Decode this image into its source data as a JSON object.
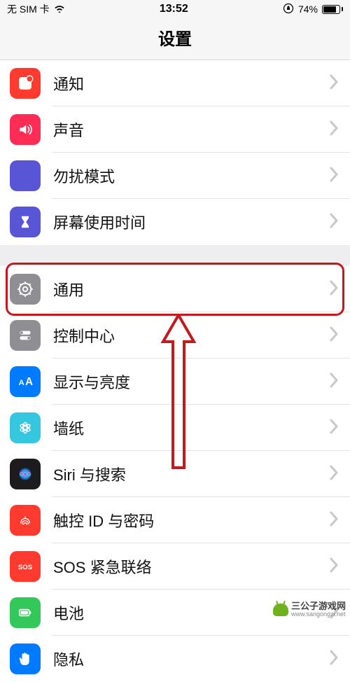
{
  "status_bar": {
    "carrier": "无 SIM 卡",
    "time": "13:52",
    "battery_percent": "74%"
  },
  "header": {
    "title": "设置"
  },
  "sections": [
    {
      "rows": [
        {
          "id": "notifications",
          "label": "通知",
          "icon_bg": "#ff3b30",
          "icon": "notification"
        },
        {
          "id": "sounds",
          "label": "声音",
          "icon_bg": "#ff2d55",
          "icon": "sound"
        },
        {
          "id": "dnd",
          "label": "勿扰模式",
          "icon_bg": "#5856d6",
          "icon": "moon"
        },
        {
          "id": "screentime",
          "label": "屏幕使用时间",
          "icon_bg": "#5856d6",
          "icon": "hourglass"
        }
      ]
    },
    {
      "rows": [
        {
          "id": "general",
          "label": "通用",
          "icon_bg": "#8e8e93",
          "icon": "gear"
        },
        {
          "id": "control-center",
          "label": "控制中心",
          "icon_bg": "#8e8e93",
          "icon": "switches"
        },
        {
          "id": "display",
          "label": "显示与亮度",
          "icon_bg": "#007aff",
          "icon": "aa"
        },
        {
          "id": "wallpaper",
          "label": "墙纸",
          "icon_bg": "#35c6e0",
          "icon": "flower"
        },
        {
          "id": "siri",
          "label": "Siri 与搜索",
          "icon_bg": "#1c1c1e",
          "icon": "siri"
        },
        {
          "id": "touchid",
          "label": "触控 ID 与密码",
          "icon_bg": "#ff3b30",
          "icon": "fingerprint"
        },
        {
          "id": "sos",
          "label": "SOS 紧急联络",
          "icon_bg": "#ff3b30",
          "icon": "sos"
        },
        {
          "id": "battery",
          "label": "电池",
          "icon_bg": "#34c759",
          "icon": "battery"
        },
        {
          "id": "privacy",
          "label": "隐私",
          "icon_bg": "#007aff",
          "icon": "hand"
        }
      ]
    }
  ],
  "highlight": {
    "row_id": "general"
  },
  "watermark": {
    "main": "三公子游戏网",
    "sub": "www.sangongzi.net"
  }
}
